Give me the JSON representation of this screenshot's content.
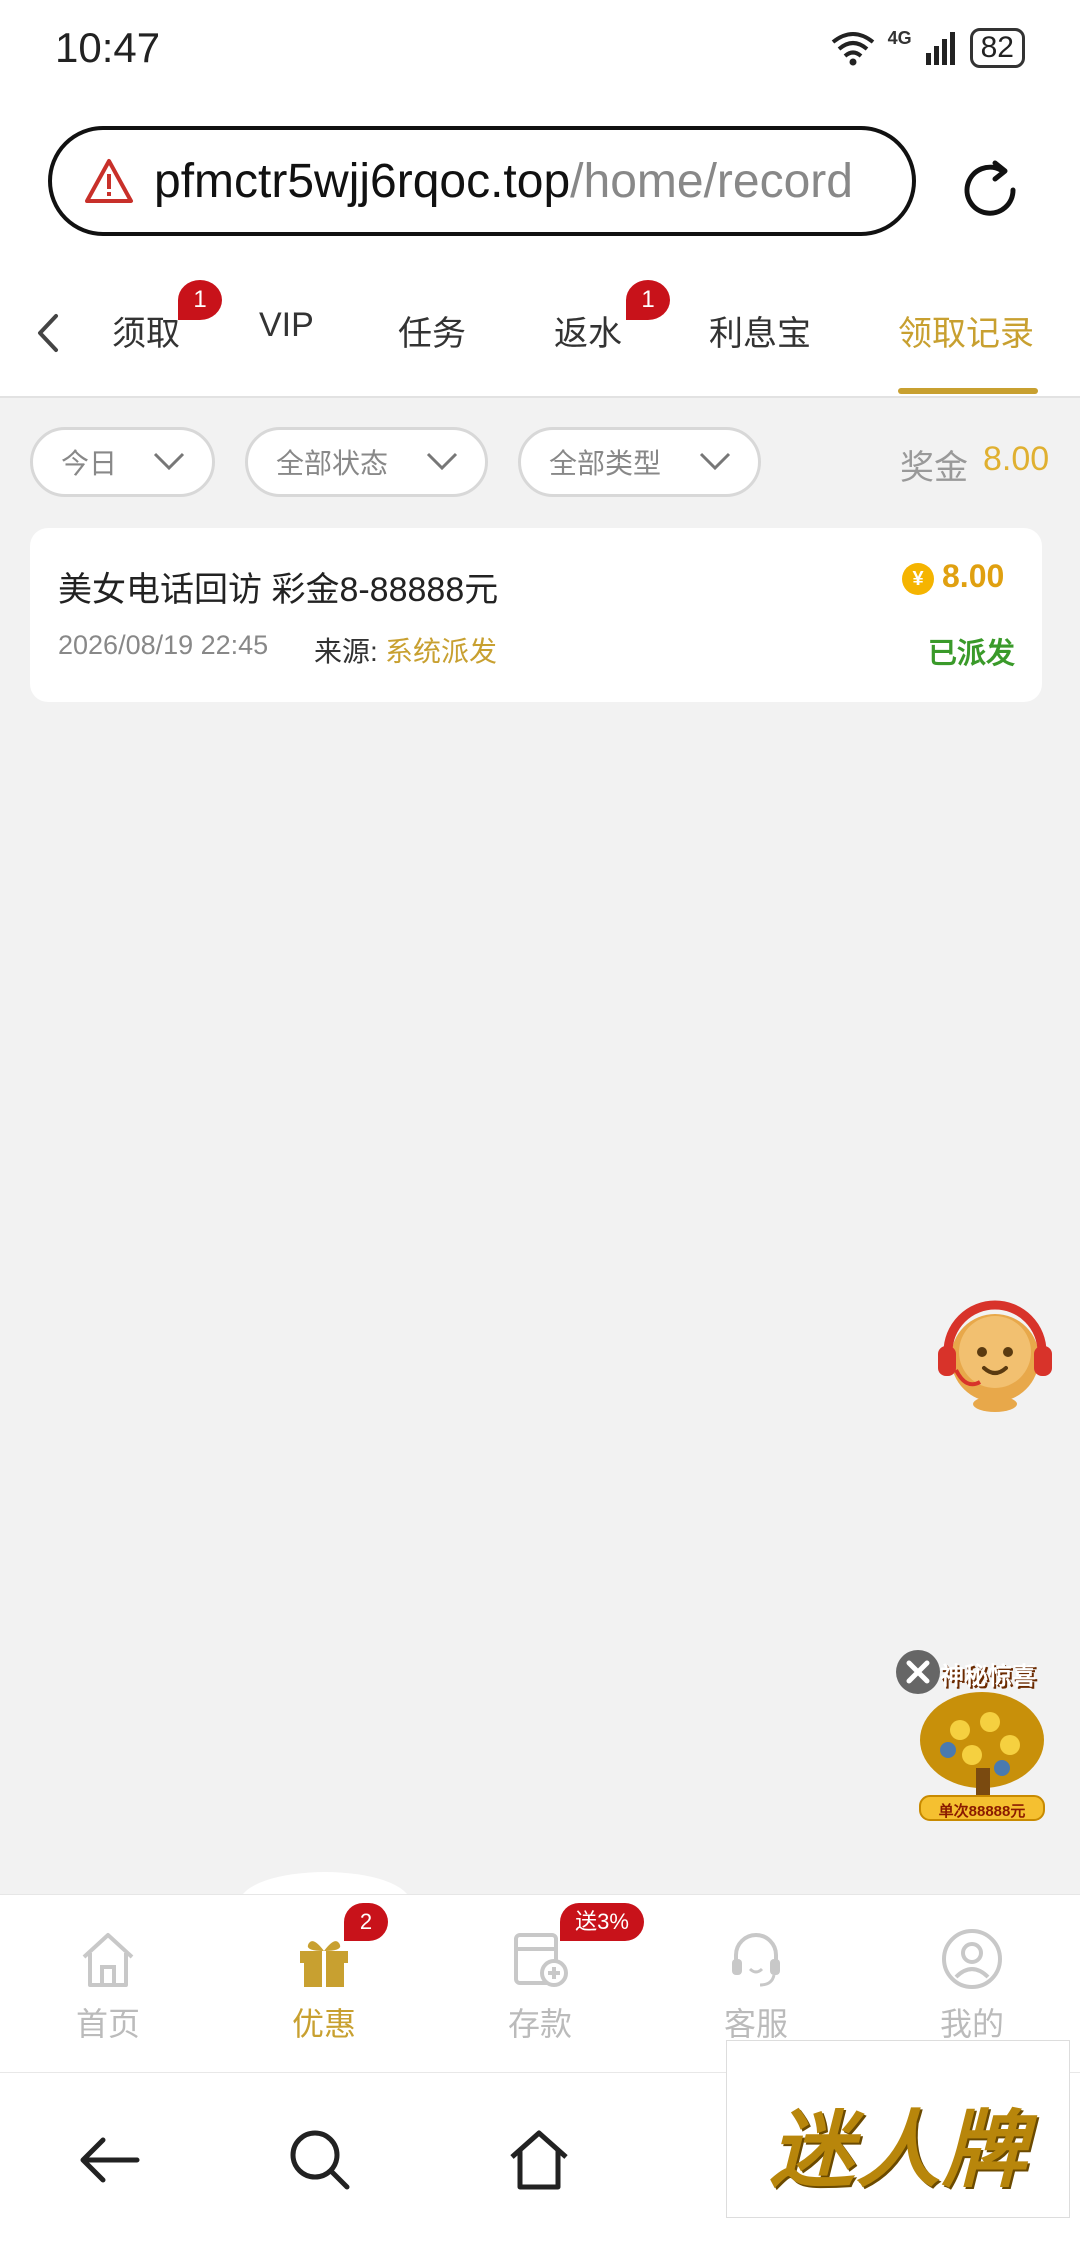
{
  "status_bar": {
    "time": "10:47",
    "network": "4G",
    "battery": "82"
  },
  "address_bar": {
    "domain": "pfmctr5wjj6rqoc.top",
    "path": "/home/record"
  },
  "tabs": [
    {
      "label": "须取",
      "badge": "1"
    },
    {
      "label": "VIP",
      "badge": ""
    },
    {
      "label": "任务",
      "badge": ""
    },
    {
      "label": "返水",
      "badge": "1"
    },
    {
      "label": "利息宝",
      "badge": ""
    },
    {
      "label": "领取记录",
      "badge": "",
      "active": true
    }
  ],
  "filters": {
    "date": "今日",
    "status": "全部状态",
    "type": "全部类型",
    "bonus_label": "奖金",
    "bonus_value": "8.00"
  },
  "records": [
    {
      "title": "美女电话回访 彩金8-88888元",
      "datetime": "2026/08/19 22:45",
      "source_label": "来源:",
      "source_value": "系统派发",
      "coin_symbol": "¥",
      "amount": "8.00",
      "status": "已派发"
    }
  ],
  "promo_float": {
    "title": "神秘惊喜",
    "caption": "单次88888元"
  },
  "bottom_nav": [
    {
      "label": "首页",
      "icon": "home-icon"
    },
    {
      "label": "优惠",
      "icon": "gift-icon",
      "badge": "2",
      "active": true
    },
    {
      "label": "存款",
      "icon": "deposit-icon",
      "badge": "送3%"
    },
    {
      "label": "客服",
      "icon": "headset-icon"
    },
    {
      "label": "我的",
      "icon": "profile-icon"
    }
  ],
  "brand": {
    "text": "迷人牌"
  },
  "colors": {
    "accent": "#c8a030",
    "badge": "#c8121a",
    "success": "#3a9a2a",
    "amount": "#e0a010"
  }
}
